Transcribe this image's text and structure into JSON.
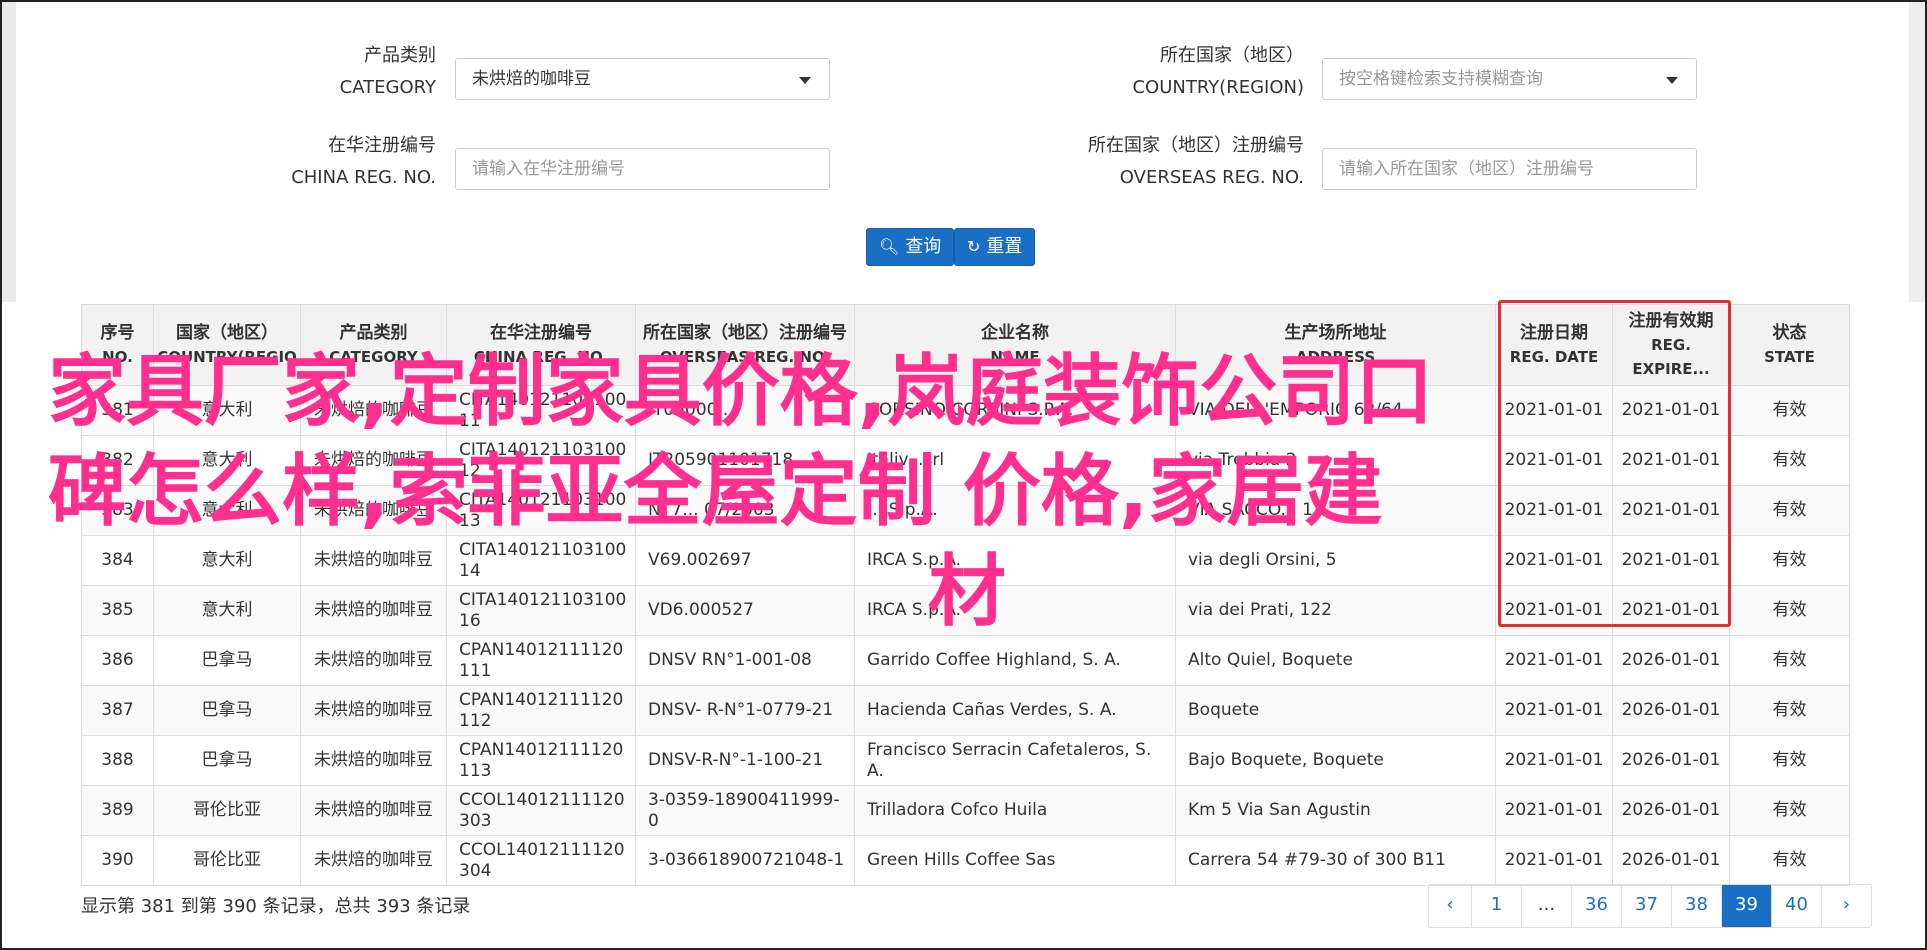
{
  "search": {
    "category_label_cn": "产品类别",
    "category_label_en": "CATEGORY",
    "category_value": "未烘焙的咖啡豆",
    "country_label_cn": "所在国家（地区）",
    "country_label_en": "COUNTRY(REGION)",
    "country_placeholder": "按空格键检索支持模糊查询",
    "china_reg_label_cn": "在华注册编号",
    "china_reg_label_en": "CHINA REG. NO.",
    "china_reg_placeholder": "请输入在华注册编号",
    "overseas_reg_label_cn": "所在国家（地区）注册编号",
    "overseas_reg_label_en": "OVERSEAS REG. NO.",
    "overseas_reg_placeholder": "请输入所在国家（地区）注册编号",
    "query_button": "查询",
    "reset_button": "重置"
  },
  "table": {
    "headers": [
      {
        "cn": "序号",
        "en": "NO."
      },
      {
        "cn": "国家（地区）",
        "en": "COUNTRY(REGIO"
      },
      {
        "cn": "产品类别",
        "en": "CATEGORY"
      },
      {
        "cn": "在华注册编号",
        "en": "CHINA REG. NO."
      },
      {
        "cn": "所在国家（地区）注册编号",
        "en": "OVERSEAS REG. NO."
      },
      {
        "cn": "企业名称",
        "en": "NAME"
      },
      {
        "cn": "生产场所地址",
        "en": "ADDRESS"
      },
      {
        "cn": "注册日期",
        "en": "REG. DATE"
      },
      {
        "cn": "注册有效期",
        "en": "REG. EXPIRE..."
      },
      {
        "cn": "状态",
        "en": "STATE"
      }
    ],
    "rows": [
      {
        "no": "381",
        "country": "意大利",
        "category": "未烘焙的咖啡豆",
        "china_reg": "CITA14012110310011",
        "overseas_reg": "IT05000...",
        "name": "CORSINO CORSINI S.P.A.",
        "address": "VIA DELL'EMPORIO 62/64",
        "reg_date": "2021-01-01",
        "expire": "2021-01-01",
        "state": "有效"
      },
      {
        "no": "382",
        "country": "意大利",
        "category": "未烘焙的咖啡豆",
        "china_reg": "CITA14012110310012",
        "overseas_reg": "IT205901101718",
        "name": "Italiv...srl",
        "address": "via Trebbia 2",
        "reg_date": "2021-01-01",
        "expire": "2021-01-01",
        "state": "有效"
      },
      {
        "no": "383",
        "country": "意大利",
        "category": "未烘焙的咖啡豆",
        "china_reg": "CITA14012110310013",
        "overseas_reg": "N. 7... 07/2003",
        "name": "... S.p.A.",
        "address": "VIA SACCO... 11",
        "reg_date": "2021-01-01",
        "expire": "2021-01-01",
        "state": "有效"
      },
      {
        "no": "384",
        "country": "意大利",
        "category": "未烘焙的咖啡豆",
        "china_reg": "CITA14012110310014",
        "overseas_reg": "V69.002697",
        "name": "IRCA S.p.A.",
        "address": "via degli Orsini, 5",
        "reg_date": "2021-01-01",
        "expire": "2021-01-01",
        "state": "有效"
      },
      {
        "no": "385",
        "country": "意大利",
        "category": "未烘焙的咖啡豆",
        "china_reg": "CITA14012110310016",
        "overseas_reg": "VD6.000527",
        "name": "IRCA S.p.A.",
        "address": "via dei Prati, 122",
        "reg_date": "2021-01-01",
        "expire": "2021-01-01",
        "state": "有效"
      },
      {
        "no": "386",
        "country": "巴拿马",
        "category": "未烘焙的咖啡豆",
        "china_reg": "CPAN14012111120111",
        "overseas_reg": "DNSV RN°1-001-08",
        "name": "Garrido Coffee Highland, S. A.",
        "address": "Alto Quiel, Boquete",
        "reg_date": "2021-01-01",
        "expire": "2026-01-01",
        "state": "有效"
      },
      {
        "no": "387",
        "country": "巴拿马",
        "category": "未烘焙的咖啡豆",
        "china_reg": "CPAN14012111120112",
        "overseas_reg": "DNSV- R-N°1-0779-21",
        "name": "Hacienda Cañas Verdes, S. A.",
        "address": "Boquete",
        "reg_date": "2021-01-01",
        "expire": "2026-01-01",
        "state": "有效"
      },
      {
        "no": "388",
        "country": "巴拿马",
        "category": "未烘焙的咖啡豆",
        "china_reg": "CPAN14012111120113",
        "overseas_reg": "DNSV-R-N°-1-100-21",
        "name": "Francisco Serracin Cafetaleros, S. A.",
        "address": "Bajo Boquete, Boquete",
        "reg_date": "2021-01-01",
        "expire": "2026-01-01",
        "state": "有效"
      },
      {
        "no": "389",
        "country": "哥伦比亚",
        "category": "未烘焙的咖啡豆",
        "china_reg": "CCOL14012111120303",
        "overseas_reg": "3-0359-18900411999-0",
        "name": "Trilladora Cofco Huila",
        "address": "Km 5 Via San Agustin",
        "reg_date": "2021-01-01",
        "expire": "2026-01-01",
        "state": "有效"
      },
      {
        "no": "390",
        "country": "哥伦比亚",
        "category": "未烘焙的咖啡豆",
        "china_reg": "CCOL14012111120304",
        "overseas_reg": "3-036618900721048-1",
        "name": "Green Hills Coffee Sas",
        "address": "Carrera 54 #79-30 of 300 B11",
        "reg_date": "2021-01-01",
        "expire": "2026-01-01",
        "state": "有效"
      }
    ]
  },
  "footer": {
    "summary": "显示第 381 到第 390 条记录，总共 393 条记录",
    "pages": [
      "‹",
      "1",
      "...",
      "36",
      "37",
      "38",
      "39",
      "40",
      "›"
    ],
    "active_page": "39"
  },
  "overlay": {
    "line1": "家具厂家,定制家具价格,岚庭装饰公司口",
    "line2": "碑怎么样,索菲亚全屋定制 价格,家居建",
    "line3": "材"
  },
  "colors": {
    "primary": "#1a6fc4",
    "highlight_box": "#e03030",
    "overlay_text": "#ff2f8e"
  }
}
